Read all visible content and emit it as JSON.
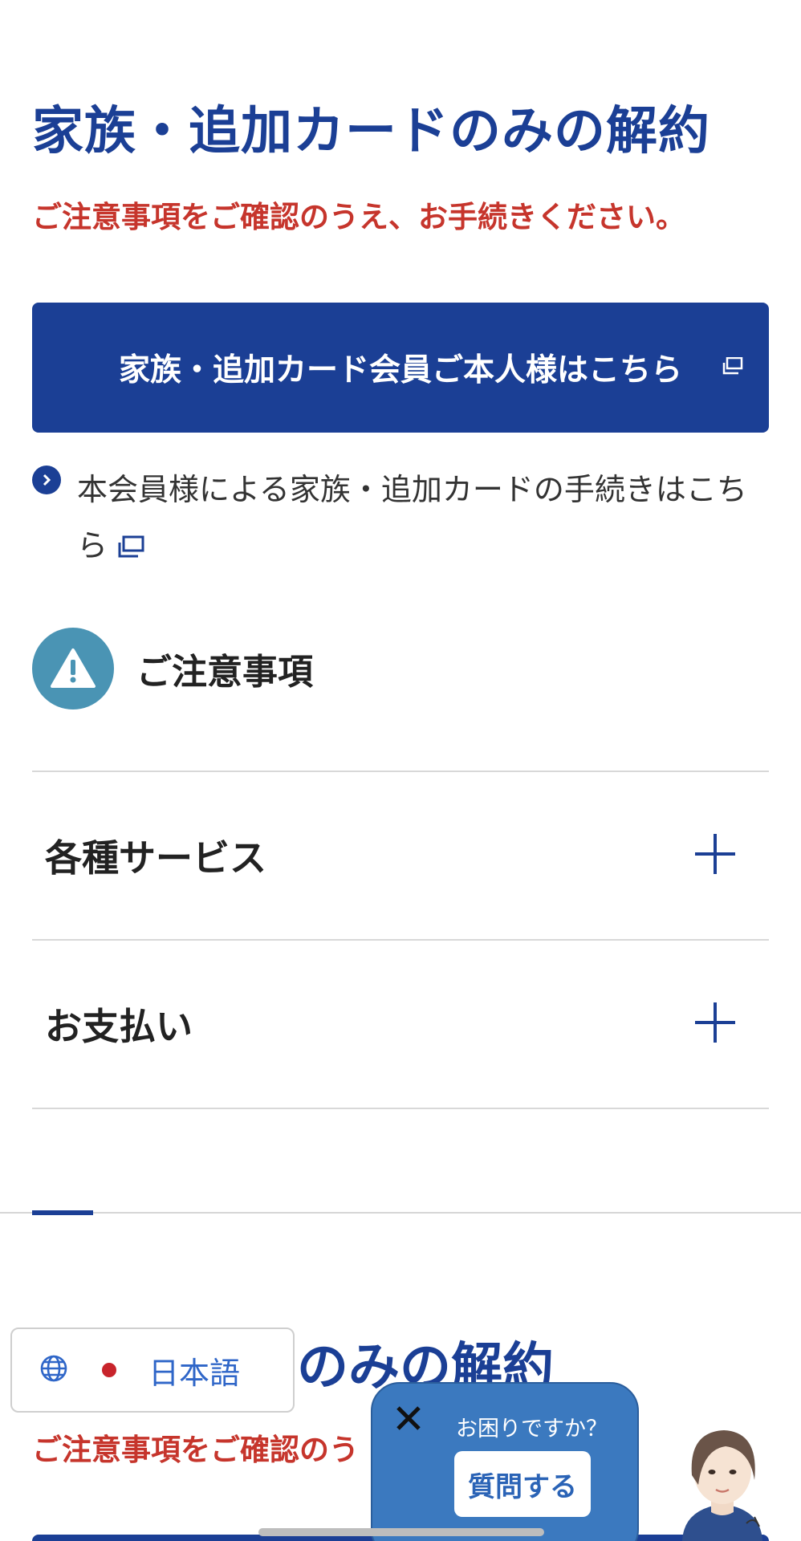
{
  "header": {
    "title": "家族・追加カードのみの解約",
    "notice": "ご注意事項をご確認のうえ、お手続きください。"
  },
  "primary_button": {
    "label": "家族・追加カード会員ご本人様はこちら"
  },
  "sublink": {
    "label": "本会員様による家族・追加カードの手続きはこちら"
  },
  "caution": {
    "title": "ご注意事項"
  },
  "accordion": [
    {
      "label": "各種サービス"
    },
    {
      "label": "お支払い"
    }
  ],
  "section2": {
    "title_visible": "のみの解約",
    "notice_visible": "ご注意事項をご確認のう"
  },
  "language": {
    "label": "日本語"
  },
  "chat": {
    "question": "お困りですか？",
    "button_label": "質問する"
  },
  "colors": {
    "brand_blue": "#1b3f95",
    "notice_red": "#c6352c",
    "warning_teal": "#4a94b4",
    "chat_blue": "#3b79bf"
  },
  "icons": [
    "external-link-icon",
    "chevron-right-icon",
    "warning-icon",
    "plus-icon",
    "globe-icon",
    "close-icon"
  ]
}
